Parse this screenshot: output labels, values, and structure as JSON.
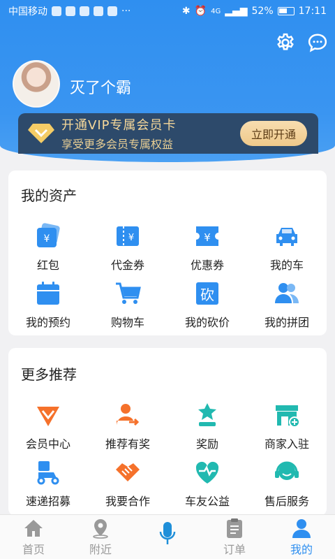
{
  "status_bar": {
    "carrier": "中国移动",
    "signal": "4G",
    "battery": "52%",
    "time": "17:11"
  },
  "profile": {
    "username": "灭了个霸"
  },
  "vip": {
    "title": "开通VIP专属会员卡",
    "subtitle": "享受更多会员专属权益",
    "button": "立即开通"
  },
  "assets": {
    "title": "我的资产",
    "items": [
      {
        "label": "红包",
        "icon": "red-packet-icon"
      },
      {
        "label": "代金券",
        "icon": "voucher-icon"
      },
      {
        "label": "优惠券",
        "icon": "coupon-icon"
      },
      {
        "label": "我的车",
        "icon": "car-icon"
      },
      {
        "label": "我的预约",
        "icon": "calendar-icon"
      },
      {
        "label": "购物车",
        "icon": "cart-icon"
      },
      {
        "label": "我的砍价",
        "icon": "bargain-icon"
      },
      {
        "label": "我的拼团",
        "icon": "group-icon"
      }
    ]
  },
  "recommend": {
    "title": "更多推荐",
    "items": [
      {
        "label": "会员中心",
        "icon": "member-center-icon"
      },
      {
        "label": "推荐有奖",
        "icon": "referral-icon"
      },
      {
        "label": "奖励",
        "icon": "reward-icon"
      },
      {
        "label": "商家入驻",
        "icon": "merchant-icon"
      },
      {
        "label": "速递招募",
        "icon": "courier-icon"
      },
      {
        "label": "我要合作",
        "icon": "handshake-icon"
      },
      {
        "label": "车友公益",
        "icon": "charity-icon"
      },
      {
        "label": "售后服务",
        "icon": "service-icon"
      }
    ]
  },
  "tabbar": {
    "items": [
      {
        "label": "首页",
        "icon": "home-icon",
        "active": false
      },
      {
        "label": "附近",
        "icon": "location-icon",
        "active": false
      },
      {
        "label": "",
        "icon": "microphone-icon",
        "active": false
      },
      {
        "label": "订单",
        "icon": "order-icon",
        "active": false
      },
      {
        "label": "我的",
        "icon": "profile-icon",
        "active": true
      }
    ]
  },
  "colors": {
    "primary": "#2f8ff0",
    "vip_bg": "#2d4a6b",
    "vip_gold": "#f6d89a",
    "orange": "#f5712b",
    "teal": "#21b9b0"
  }
}
